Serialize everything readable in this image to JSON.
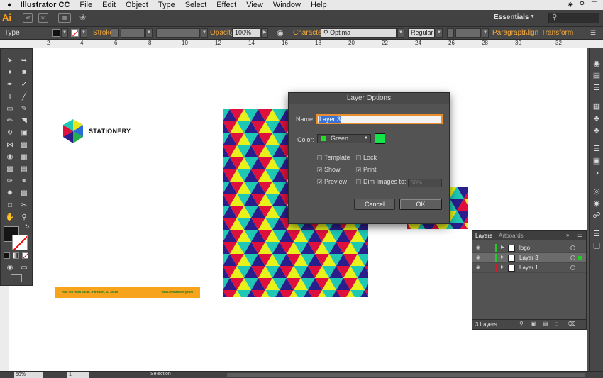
{
  "menubar": {
    "apple_icon": "",
    "app_name": "Illustrator CC",
    "items": [
      "File",
      "Edit",
      "Object",
      "Type",
      "Select",
      "Effect",
      "View",
      "Window",
      "Help"
    ]
  },
  "appbar": {
    "logo": "Ai",
    "workspace": "Essentials",
    "search_placeholder": ""
  },
  "controlbar": {
    "context": "Type",
    "stroke_label": "Stroke:",
    "opacity_label": "Opacity:",
    "opacity_value": "100%",
    "character_label": "Character:",
    "font_value": "Optima",
    "font_style": "Regular",
    "paragraph_label": "Paragraph",
    "align_label": "Align",
    "transform_label": "Transform"
  },
  "ruler": {
    "ticks": [
      "2",
      "4",
      "6",
      "8",
      "10",
      "12",
      "14",
      "16",
      "18",
      "20",
      "22",
      "24",
      "26",
      "28",
      "30",
      "32"
    ]
  },
  "artwork": {
    "logo_text": "STATIONERY",
    "footer_address": "7681 5th Road South - Harrison, NJ 18689",
    "footer_url": "www.mystationery.com",
    "colors": {
      "orange": "#f7a31c",
      "yellow": "#e8f21a",
      "teal": "#1ec8b4",
      "navy": "#2a1e8c",
      "red": "#e0103c"
    }
  },
  "dialog": {
    "title": "Layer Options",
    "name_label": "Name:",
    "name_value": "Layer 3",
    "color_label": "Color:",
    "color_value": "Green",
    "color_hex": "#14e34a",
    "template_label": "Template",
    "lock_label": "Lock",
    "show_label": "Show",
    "print_label": "Print",
    "preview_label": "Preview",
    "dim_label": "Dim Images to:",
    "dim_value": "50%",
    "cancel_label": "Cancel",
    "ok_label": "OK",
    "checks": {
      "template": false,
      "lock": false,
      "show": true,
      "print": true,
      "preview": true,
      "dim": false
    }
  },
  "layers_panel": {
    "tab_layers": "Layers",
    "tab_artboards": "Artboards",
    "rows": [
      {
        "name": "logo",
        "color": "#22cc22",
        "selected": false
      },
      {
        "name": "Layer 3",
        "color": "#22cc22",
        "selected": true
      },
      {
        "name": "Layer 1",
        "color": "#d01c2c",
        "selected": false
      }
    ],
    "count_text": "3 Layers"
  },
  "statusbar": {
    "zoom": "50%",
    "artboard": "1",
    "tool": "Selection"
  }
}
